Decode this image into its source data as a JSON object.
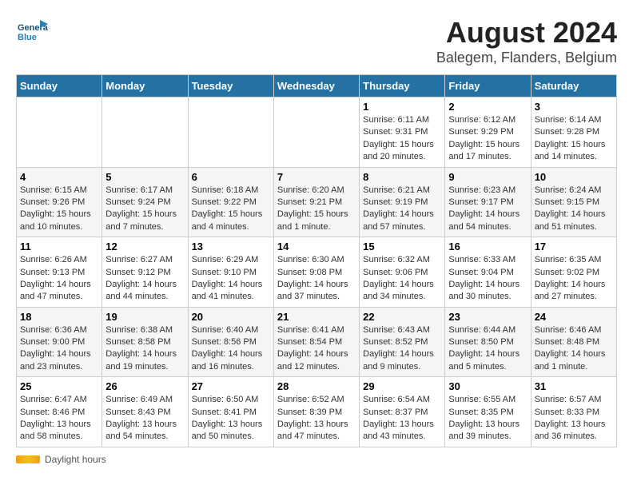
{
  "header": {
    "logo_general": "General",
    "logo_blue": "Blue",
    "title": "August 2024",
    "subtitle": "Balegem, Flanders, Belgium"
  },
  "footer": {
    "daylight_label": "Daylight hours"
  },
  "calendar": {
    "headers": [
      "Sunday",
      "Monday",
      "Tuesday",
      "Wednesday",
      "Thursday",
      "Friday",
      "Saturday"
    ],
    "weeks": [
      [
        {
          "day": "",
          "info": ""
        },
        {
          "day": "",
          "info": ""
        },
        {
          "day": "",
          "info": ""
        },
        {
          "day": "",
          "info": ""
        },
        {
          "day": "1",
          "info": "Sunrise: 6:11 AM\nSunset: 9:31 PM\nDaylight: 15 hours and 20 minutes."
        },
        {
          "day": "2",
          "info": "Sunrise: 6:12 AM\nSunset: 9:29 PM\nDaylight: 15 hours and 17 minutes."
        },
        {
          "day": "3",
          "info": "Sunrise: 6:14 AM\nSunset: 9:28 PM\nDaylight: 15 hours and 14 minutes."
        }
      ],
      [
        {
          "day": "4",
          "info": "Sunrise: 6:15 AM\nSunset: 9:26 PM\nDaylight: 15 hours and 10 minutes."
        },
        {
          "day": "5",
          "info": "Sunrise: 6:17 AM\nSunset: 9:24 PM\nDaylight: 15 hours and 7 minutes."
        },
        {
          "day": "6",
          "info": "Sunrise: 6:18 AM\nSunset: 9:22 PM\nDaylight: 15 hours and 4 minutes."
        },
        {
          "day": "7",
          "info": "Sunrise: 6:20 AM\nSunset: 9:21 PM\nDaylight: 15 hours and 1 minute."
        },
        {
          "day": "8",
          "info": "Sunrise: 6:21 AM\nSunset: 9:19 PM\nDaylight: 14 hours and 57 minutes."
        },
        {
          "day": "9",
          "info": "Sunrise: 6:23 AM\nSunset: 9:17 PM\nDaylight: 14 hours and 54 minutes."
        },
        {
          "day": "10",
          "info": "Sunrise: 6:24 AM\nSunset: 9:15 PM\nDaylight: 14 hours and 51 minutes."
        }
      ],
      [
        {
          "day": "11",
          "info": "Sunrise: 6:26 AM\nSunset: 9:13 PM\nDaylight: 14 hours and 47 minutes."
        },
        {
          "day": "12",
          "info": "Sunrise: 6:27 AM\nSunset: 9:12 PM\nDaylight: 14 hours and 44 minutes."
        },
        {
          "day": "13",
          "info": "Sunrise: 6:29 AM\nSunset: 9:10 PM\nDaylight: 14 hours and 41 minutes."
        },
        {
          "day": "14",
          "info": "Sunrise: 6:30 AM\nSunset: 9:08 PM\nDaylight: 14 hours and 37 minutes."
        },
        {
          "day": "15",
          "info": "Sunrise: 6:32 AM\nSunset: 9:06 PM\nDaylight: 14 hours and 34 minutes."
        },
        {
          "day": "16",
          "info": "Sunrise: 6:33 AM\nSunset: 9:04 PM\nDaylight: 14 hours and 30 minutes."
        },
        {
          "day": "17",
          "info": "Sunrise: 6:35 AM\nSunset: 9:02 PM\nDaylight: 14 hours and 27 minutes."
        }
      ],
      [
        {
          "day": "18",
          "info": "Sunrise: 6:36 AM\nSunset: 9:00 PM\nDaylight: 14 hours and 23 minutes."
        },
        {
          "day": "19",
          "info": "Sunrise: 6:38 AM\nSunset: 8:58 PM\nDaylight: 14 hours and 19 minutes."
        },
        {
          "day": "20",
          "info": "Sunrise: 6:40 AM\nSunset: 8:56 PM\nDaylight: 14 hours and 16 minutes."
        },
        {
          "day": "21",
          "info": "Sunrise: 6:41 AM\nSunset: 8:54 PM\nDaylight: 14 hours and 12 minutes."
        },
        {
          "day": "22",
          "info": "Sunrise: 6:43 AM\nSunset: 8:52 PM\nDaylight: 14 hours and 9 minutes."
        },
        {
          "day": "23",
          "info": "Sunrise: 6:44 AM\nSunset: 8:50 PM\nDaylight: 14 hours and 5 minutes."
        },
        {
          "day": "24",
          "info": "Sunrise: 6:46 AM\nSunset: 8:48 PM\nDaylight: 14 hours and 1 minute."
        }
      ],
      [
        {
          "day": "25",
          "info": "Sunrise: 6:47 AM\nSunset: 8:46 PM\nDaylight: 13 hours and 58 minutes."
        },
        {
          "day": "26",
          "info": "Sunrise: 6:49 AM\nSunset: 8:43 PM\nDaylight: 13 hours and 54 minutes."
        },
        {
          "day": "27",
          "info": "Sunrise: 6:50 AM\nSunset: 8:41 PM\nDaylight: 13 hours and 50 minutes."
        },
        {
          "day": "28",
          "info": "Sunrise: 6:52 AM\nSunset: 8:39 PM\nDaylight: 13 hours and 47 minutes."
        },
        {
          "day": "29",
          "info": "Sunrise: 6:54 AM\nSunset: 8:37 PM\nDaylight: 13 hours and 43 minutes."
        },
        {
          "day": "30",
          "info": "Sunrise: 6:55 AM\nSunset: 8:35 PM\nDaylight: 13 hours and 39 minutes."
        },
        {
          "day": "31",
          "info": "Sunrise: 6:57 AM\nSunset: 8:33 PM\nDaylight: 13 hours and 36 minutes."
        }
      ]
    ]
  }
}
